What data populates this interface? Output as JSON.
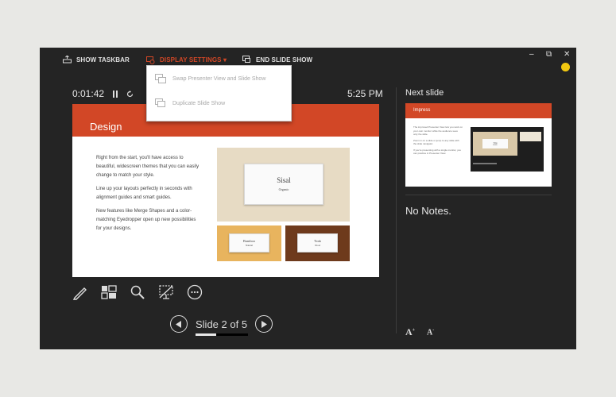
{
  "toolbar": {
    "show_taskbar": "SHOW TASKBAR",
    "display_settings": "DISPLAY SETTINGS ▾",
    "end_slide_show": "END SLIDE SHOW"
  },
  "window_controls": {
    "minimize": "–",
    "restore": "⧉",
    "close": "✕"
  },
  "dropdown": {
    "items": [
      "Swap Presenter View and Slide Show",
      "Duplicate Slide Show"
    ]
  },
  "timer": "0:01:42",
  "clock": "5:25 PM",
  "current_slide": {
    "title": "Design",
    "paragraphs": [
      "Right from the start, you'll have access to beautiful, widescreen themes that you can easily change to match your style.",
      "Line up your layouts perfectly in seconds with alignment guides and smart guides.",
      "New features like Merge Shapes and a color-matching Eyedropper open up new possibilities for your designs."
    ],
    "thumbs": {
      "main_title": "Sisal",
      "main_sub": "Organic",
      "left_title": "Bamboo",
      "left_sub": "Natural",
      "right_title": "Teak",
      "right_sub": "Wood"
    }
  },
  "navigation": {
    "label": "Slide 2 of 5",
    "progress": 0.4
  },
  "next_slide": {
    "heading": "Next slide",
    "title": "Impress",
    "paragraphs": [
      "The improved Presenter View lets you work on your own monitor while the audience sees only the slide.",
      "Zoom in on a slide or jump to any slide with the slide navigator.",
      "If you're presenting with a single monitor, you can practice in Presenter View."
    ],
    "thumb_title": "Title",
    "thumb_sub": "Subtitle"
  },
  "notes": "No Notes.",
  "colors": {
    "accent": "#d24726",
    "background": "#242424"
  }
}
